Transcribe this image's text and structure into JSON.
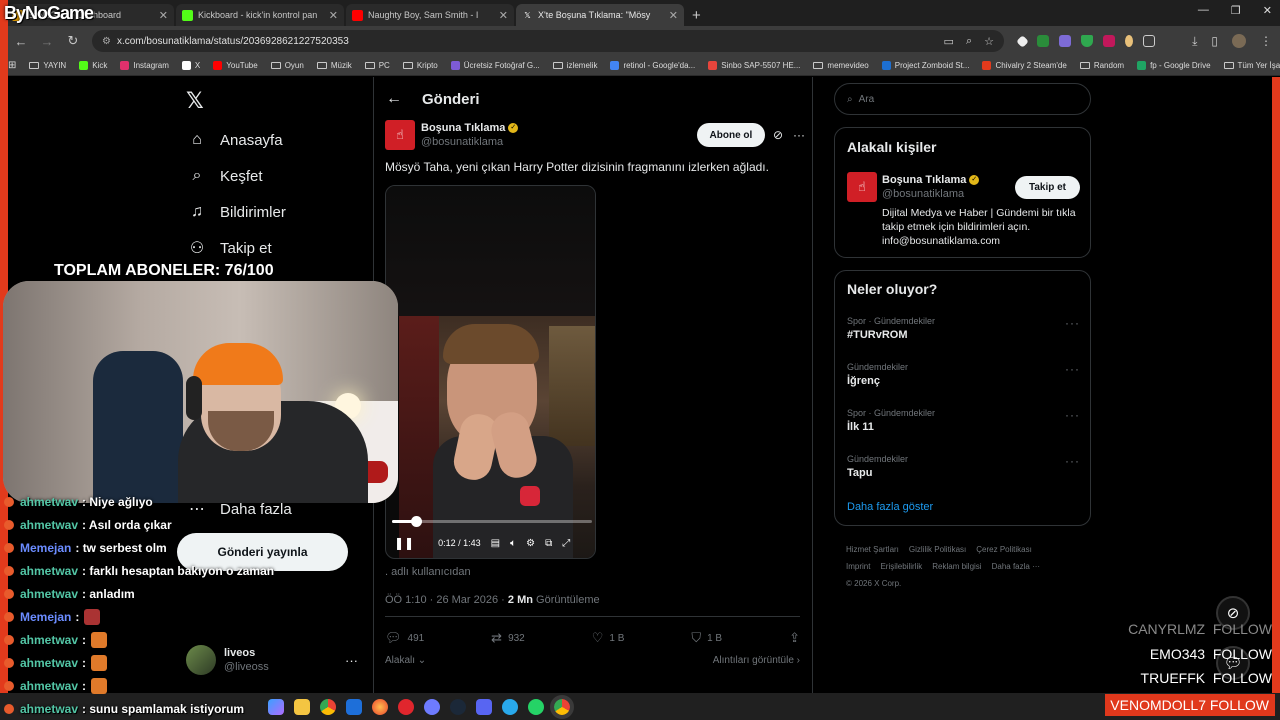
{
  "browser": {
    "tabs": [
      {
        "label": "ByNoGame Dashboard",
        "fav_color": "#f0a500",
        "active": false
      },
      {
        "label": "Kickboard - kick'in kontrol pan",
        "fav_color": "#53fc18",
        "active": false
      },
      {
        "label": "Naughty Boy, Sam Smith - I",
        "fav_color": "#ff0000",
        "active": false
      },
      {
        "label": "X'te Boşuna Tıklama: \"Mösy",
        "fav_color": "#ffffff",
        "active": true
      }
    ],
    "url": "x.com/bosunatiklama/status/2036928621227520353",
    "bookmarks": [
      "YAYIN",
      "Kick",
      "Instagram",
      "X",
      "YouTube",
      "Oyun",
      "Müzik",
      "PC",
      "Kripto",
      "Ücretsiz Fotoğraf G...",
      "izlemelik",
      "retinol - Google'da...",
      "Sinbo SAP-5507 HE...",
      "memevideo",
      "Project Zomboid St...",
      "Chivalry 2 Steam'de",
      "Random",
      "fp - Google Drive"
    ],
    "bookmarks_right": "Tüm Yer İşaretleri"
  },
  "overlay": {
    "brand": "ByNoGame",
    "subs": "TOPLAM ABONELER: 76/100",
    "chat": [
      {
        "user": "ahmetwav",
        "text": ": Niye ağlıyo",
        "color": "#53c6a6",
        "emote": null
      },
      {
        "user": "ahmetwav",
        "text": ": Asıl orda çıkar",
        "color": "#53c6a6",
        "emote": null
      },
      {
        "user": "Memejan",
        "text": ": tw serbest olm",
        "color": "#6b8cff",
        "emote": null
      },
      {
        "user": "ahmetwav",
        "text": ": farklı hesaptan bakıyon o zaman",
        "color": "#53c6a6",
        "emote": null
      },
      {
        "user": "ahmetwav",
        "text": ": anladım",
        "color": "#53c6a6",
        "emote": null
      },
      {
        "user": "Memejan",
        "text": ":",
        "color": "#6b8cff",
        "emote": "#a33"
      },
      {
        "user": "ahmetwav",
        "text": ":",
        "color": "#53c6a6",
        "emote": "#e07a2a"
      },
      {
        "user": "ahmetwav",
        "text": ":",
        "color": "#53c6a6",
        "emote": "#e07a2a"
      },
      {
        "user": "ahmetwav",
        "text": ":",
        "color": "#53c6a6",
        "emote": "#e07a2a"
      },
      {
        "user": "ahmetwav",
        "text": ": sunu spamlamak istiyorum",
        "color": "#53c6a6",
        "emote": null
      }
    ],
    "followers": [
      "CANYRLMZ  FOLLOW",
      "EMO343  FOLLOW",
      "TRUEFFK  FOLLOW"
    ],
    "latest_follow": "VENOMDOLL7  FOLLOW"
  },
  "nav": {
    "items": [
      {
        "label": "Anasayfa",
        "icon": "home-icon",
        "glyph": "⌂"
      },
      {
        "label": "Keşfet",
        "icon": "search-icon",
        "glyph": "⌕"
      },
      {
        "label": "Bildirimler",
        "icon": "bell-icon",
        "glyph": "♫"
      },
      {
        "label": "Takip et",
        "icon": "person-add-icon",
        "glyph": "⚇"
      }
    ],
    "more": "Daha fazla",
    "post_button": "Gönderi yayınla",
    "account": {
      "name": "liveos",
      "handle": "@liveoss"
    }
  },
  "post": {
    "header": "Gönderi",
    "author_name": "Boşuna Tıklama",
    "author_handle": "@bosunatiklama",
    "subscribe": "Abone ol",
    "text": "Mösyö Taha, yeni çıkan Harry Potter dizisinin fragmanını izlerken ağladı.",
    "video": {
      "time": "0:12 / 1:43",
      "progress_fraction": 0.12
    },
    "source_note": ". adlı kullanıcıdan",
    "timestamp": "ÖÖ 1:10 · 26 Mar 2026 ·",
    "views_count": "2 Mn",
    "views_label": "Görüntüleme",
    "stats": {
      "replies": "491",
      "reposts": "932",
      "likes": "1 B",
      "bookmarks": "1 B"
    },
    "related": "Alakalı",
    "quotes": "Alıntıları görüntüle"
  },
  "sidebar": {
    "search_placeholder": "Ara",
    "related_title": "Alakalı kişiler",
    "person": {
      "name": "Boşuna Tıklama",
      "handle": "@bosunatiklama",
      "follow": "Takip et",
      "bio": "Dijital Medya ve Haber | Gündemi bir tıkla takip etmek için bildirimleri açın. info@bosunatiklama.com"
    },
    "trends_title": "Neler oluyor?",
    "trends": [
      {
        "context": "Spor · Gündemdekiler",
        "name": "#TURvROM"
      },
      {
        "context": "Gündemdekiler",
        "name": "İğrenç"
      },
      {
        "context": "Spor · Gündemdekiler",
        "name": "İlk 11"
      },
      {
        "context": "Gündemdekiler",
        "name": "Tapu"
      }
    ],
    "show_more": "Daha fazla göster",
    "footer": [
      "Hizmet Şartları",
      "Gizlilik Politikası",
      "Çerez Politikası",
      "Imprint",
      "Erişilebilirlik",
      "Reklam bilgisi",
      "Daha fazla ···",
      "© 2026 X Corp."
    ]
  },
  "colors": {
    "accent": "#1d9bf0",
    "stream_red": "#e23a1c",
    "verified": "#e2b719"
  }
}
